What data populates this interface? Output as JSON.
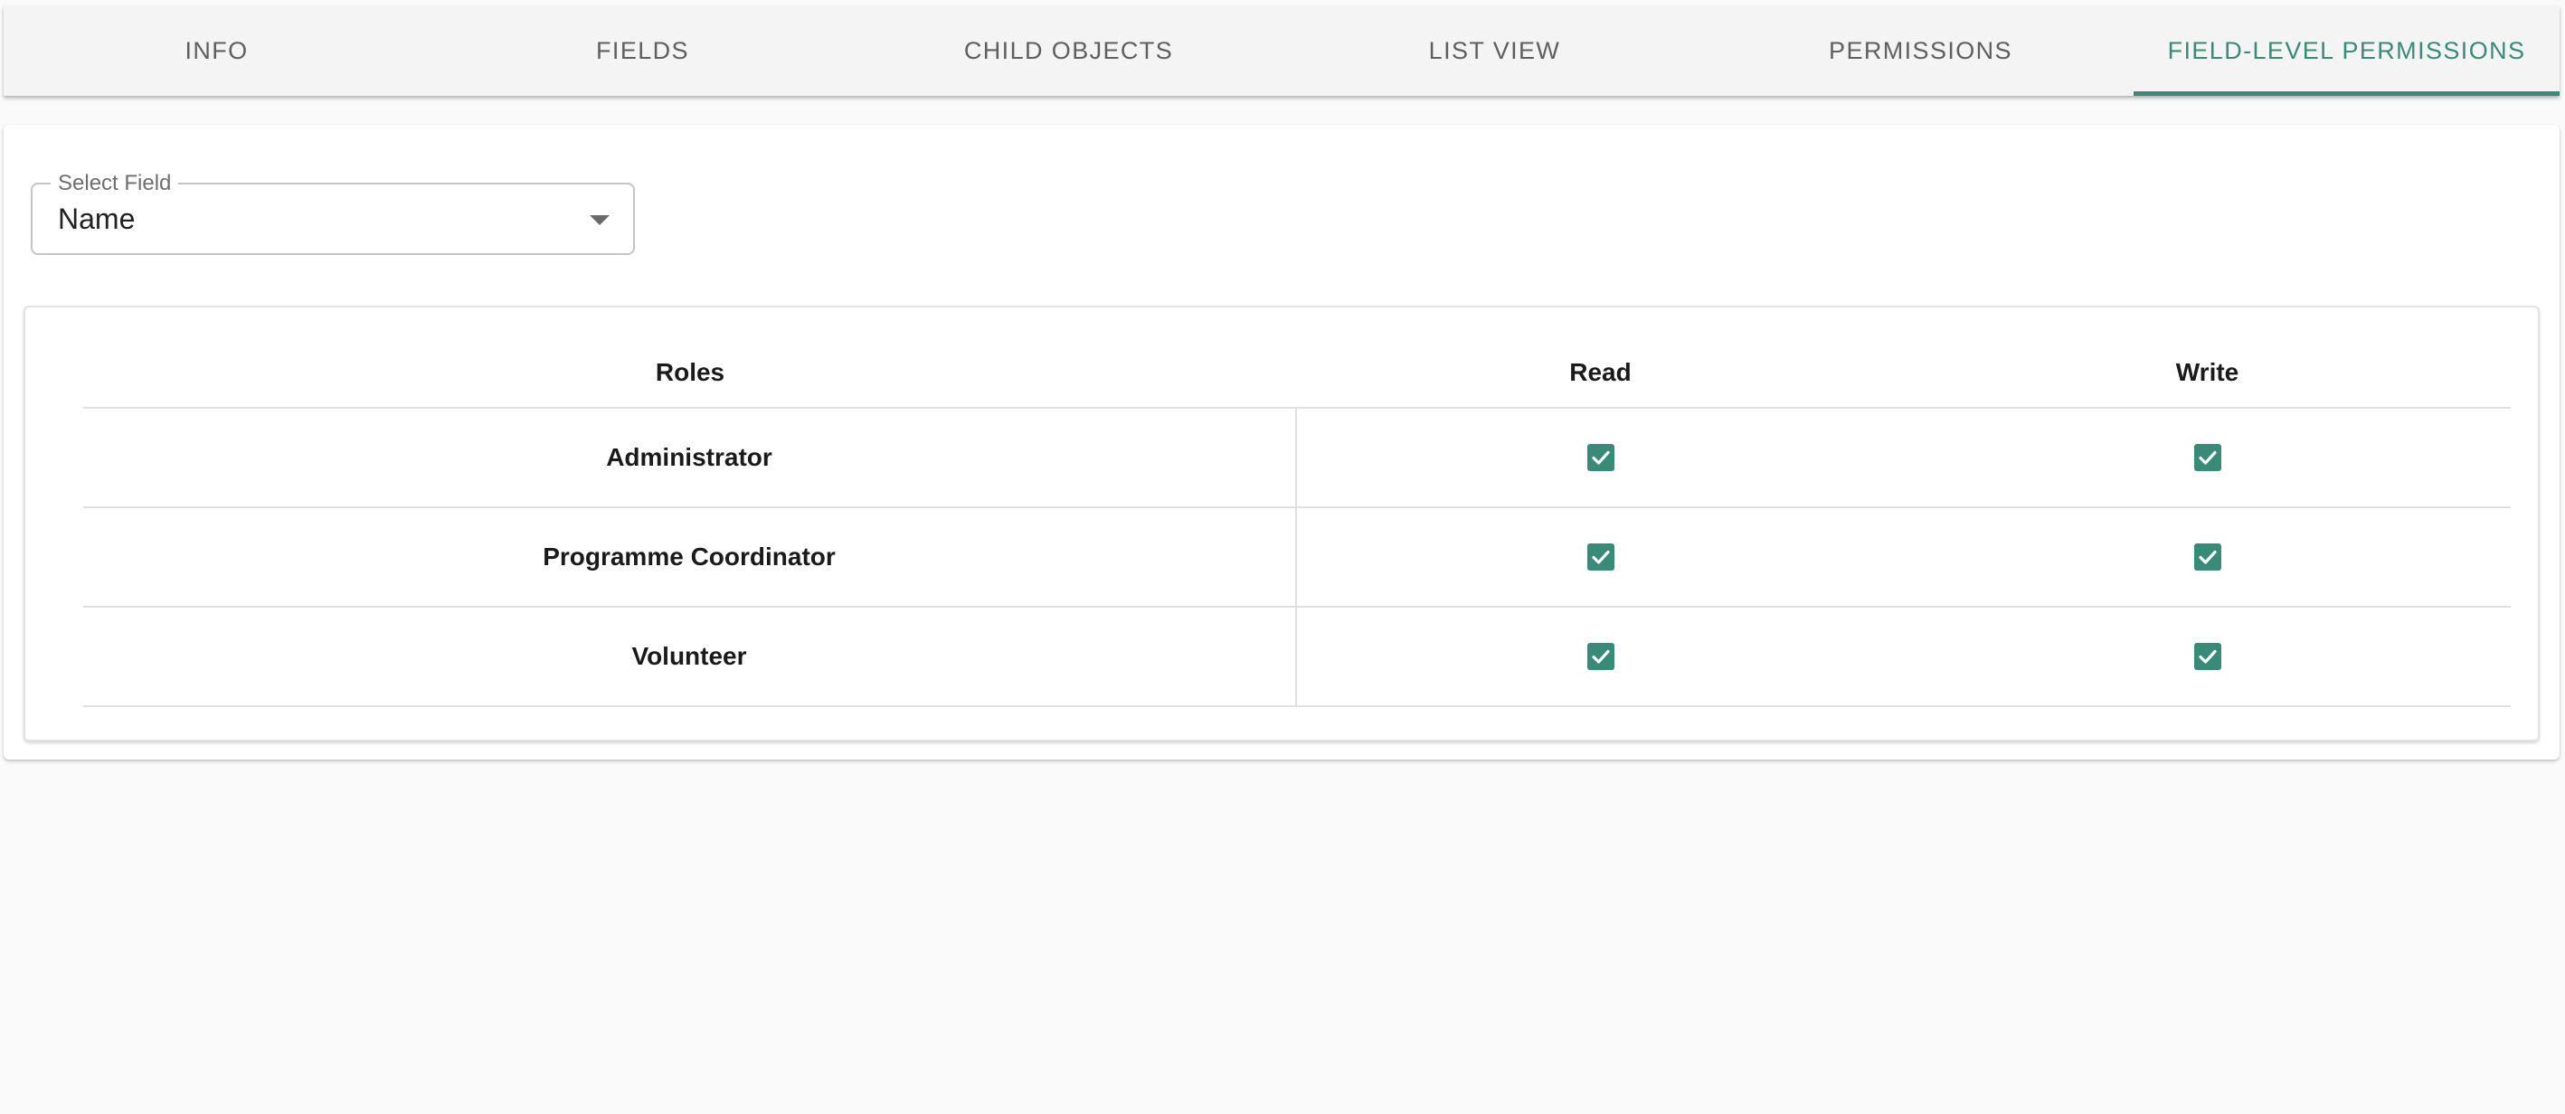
{
  "tabs": [
    {
      "label": "INFO",
      "active": false
    },
    {
      "label": "FIELDS",
      "active": false
    },
    {
      "label": "CHILD OBJECTS",
      "active": false
    },
    {
      "label": "LIST VIEW",
      "active": false
    },
    {
      "label": "PERMISSIONS",
      "active": false
    },
    {
      "label": "FIELD-LEVEL PERMISSIONS",
      "active": true
    }
  ],
  "field_select": {
    "label": "Select Field",
    "value": "Name",
    "icon": "arrow-drop-down-icon"
  },
  "table": {
    "headers": {
      "roles": "Roles",
      "read": "Read",
      "write": "Write"
    },
    "rows": [
      {
        "role": "Administrator",
        "read": true,
        "write": true
      },
      {
        "role": "Programme Coordinator",
        "read": true,
        "write": true
      },
      {
        "role": "Volunteer",
        "read": true,
        "write": true
      }
    ]
  },
  "colors": {
    "accent": "#3a8a78",
    "tab_text": "#5f5f5f",
    "background": "#fafafa"
  }
}
